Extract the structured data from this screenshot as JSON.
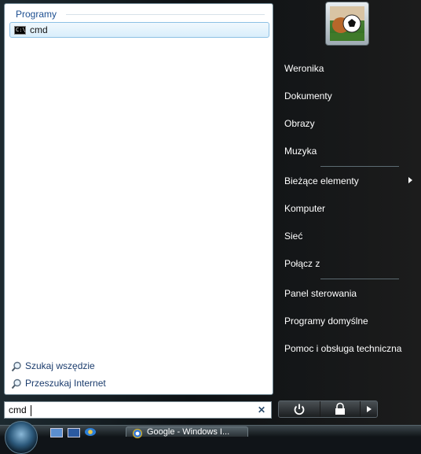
{
  "left_pane": {
    "section_header": "Programy",
    "results": [
      {
        "label": "cmd",
        "icon": "command-prompt-icon"
      }
    ],
    "search_links": [
      {
        "label": "Szukaj wszędzie",
        "icon": "search-icon"
      },
      {
        "label": "Przeszukaj Internet",
        "icon": "search-icon"
      }
    ]
  },
  "search": {
    "value": "cmd",
    "clear_icon": "clear-icon"
  },
  "right_pane": {
    "user_picture": "user-avatar-football",
    "items": [
      {
        "label": "Weronika"
      },
      {
        "label": "Dokumenty"
      },
      {
        "label": "Obrazy"
      },
      {
        "label": "Muzyka"
      },
      {
        "label": "Bieżące elementy",
        "has_submenu": true
      },
      {
        "label": "Komputer"
      },
      {
        "label": "Sieć"
      },
      {
        "label": "Połącz z"
      },
      {
        "label": "Panel sterowania"
      },
      {
        "label": "Programy domyślne"
      },
      {
        "label": "Pomoc i obsługa techniczna"
      }
    ]
  },
  "power": {
    "power_icon": "power-icon",
    "lock_icon": "lock-icon",
    "more_icon": "arrow-right-icon"
  },
  "taskbar": {
    "task_button_label": "Google - Windows I..."
  },
  "colors": {
    "header_blue": "#1d4f91",
    "selection_border": "#8dc0e4",
    "right_text": "#ffffff"
  }
}
